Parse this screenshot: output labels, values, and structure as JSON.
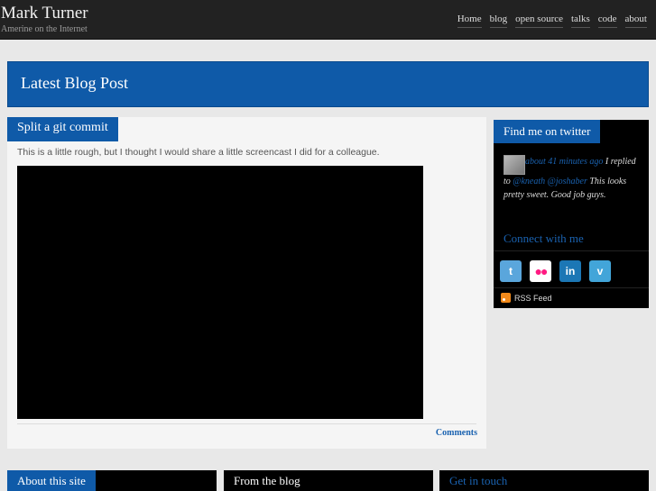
{
  "site": {
    "title": "Mark Turner",
    "tagline": "Amerine on the Internet"
  },
  "nav": {
    "items": [
      "Home",
      "blog",
      "open source",
      "talks",
      "code",
      "about"
    ]
  },
  "banner": {
    "title": "Latest Blog Post"
  },
  "post": {
    "title": "Split a git commit",
    "body": "This is a little rough, but I thought I would share a little screencast I did for a colleague.",
    "comments_label": "Comments"
  },
  "sidebar": {
    "twitter_title": "Find me on twitter",
    "tweet": {
      "time": "about 41 minutes ago",
      "text_prefix": " I replied to ",
      "mention_1": "@kneath",
      "mention_2": "@joshaber",
      "text_suffix": " This looks pretty sweet. Good job guys."
    },
    "connect_title": "Connect with me",
    "social": [
      {
        "name": "twitter-icon",
        "glyph": "t"
      },
      {
        "name": "flickr-icon",
        "glyph": "●●"
      },
      {
        "name": "linkedin-icon",
        "glyph": "in"
      },
      {
        "name": "vimeo-icon",
        "glyph": "v"
      }
    ],
    "rss_label": "RSS Feed"
  },
  "footer_sections": {
    "about": "About this site",
    "blog": "From the blog",
    "contact": "Get in touch"
  },
  "colors": {
    "accent": "#0f5aa8",
    "link": "#1a62b0",
    "header_bg": "#222222"
  }
}
